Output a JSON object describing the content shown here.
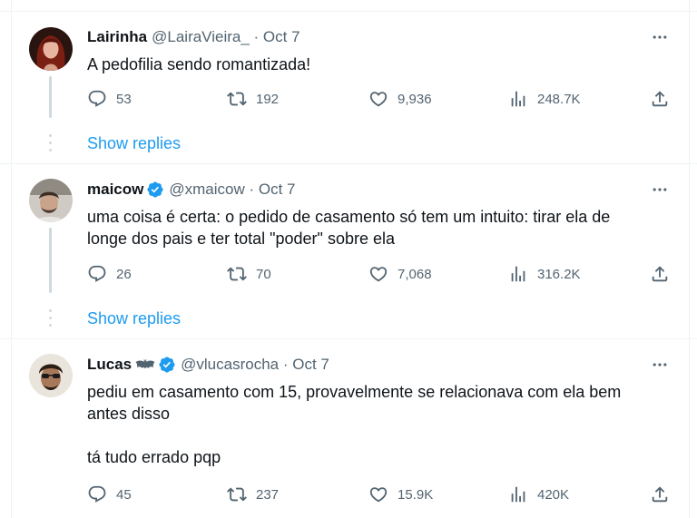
{
  "tweets": [
    {
      "name": "Lairinha",
      "handle": "@LairaVieira_ · Oct 7",
      "verified": false,
      "text": [
        "A pedofilia sendo romantizada!"
      ],
      "replies": "53",
      "retweets": "192",
      "likes": "9,936",
      "views": "248.7K",
      "show_replies": "Show replies"
    },
    {
      "name": "maicow",
      "handle": "@xmaicow · Oct 7",
      "verified": true,
      "text": [
        "uma coisa é certa: o pedido de casamento só tem um intuito: tirar ela de",
        "longe dos pais e ter total \"poder\" sobre ela"
      ],
      "replies": "26",
      "retweets": "70",
      "likes": "7,068",
      "views": "316.2K",
      "show_replies": "Show replies"
    },
    {
      "name": "Lucas",
      "handle": "@vlucasrocha · Oct 7",
      "verified": true,
      "text": [
        "pediu em casamento com 15, provavelmente se relacionava com ela bem",
        "antes disso",
        "",
        "tá tudo errado pqp"
      ],
      "replies": "45",
      "retweets": "237",
      "likes": "15.9K",
      "views": "420K"
    }
  ],
  "colors": {
    "accent": "#1d9bf0",
    "muted": "#536471",
    "border": "#eff3f4",
    "thread": "#cfd9de"
  },
  "icons": [
    "reply-icon",
    "retweet-icon",
    "like-icon",
    "views-icon",
    "share-icon",
    "more-icon",
    "verified-icon",
    "bat-emoji-icon"
  ]
}
